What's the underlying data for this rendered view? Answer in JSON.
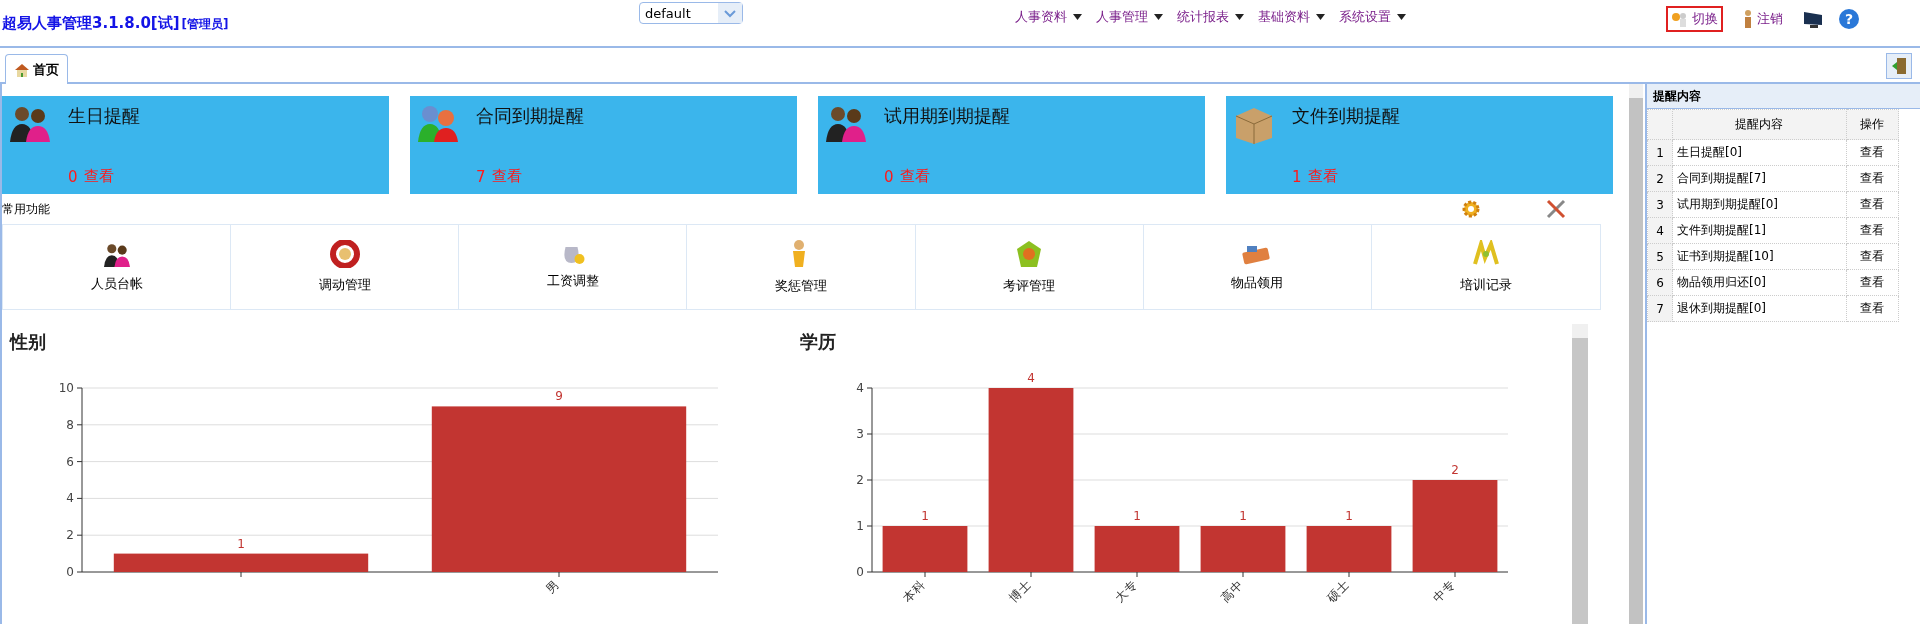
{
  "header": {
    "title": "超易人事管理3.1.8.0[试]",
    "role": "[管理员]",
    "theme_select": {
      "value": "default"
    },
    "menu": [
      {
        "label": "人事资料"
      },
      {
        "label": "人事管理"
      },
      {
        "label": "统计报表"
      },
      {
        "label": "基础资料"
      },
      {
        "label": "系统设置"
      }
    ],
    "actions": [
      {
        "label": "切换",
        "selected": true
      },
      {
        "label": "注销",
        "selected": false
      }
    ],
    "help_glyph": "?"
  },
  "tabs": [
    {
      "label": "首页",
      "selected": true
    }
  ],
  "reminder_cards": [
    {
      "title": "生日提醒",
      "count": "0",
      "link": "查看"
    },
    {
      "title": "合同到期提醒",
      "count": "7",
      "link": "查看"
    },
    {
      "title": "试用期到期提醒",
      "count": "0",
      "link": "查看"
    },
    {
      "title": "文件到期提醒",
      "count": "1",
      "link": "查看"
    }
  ],
  "common_functions": {
    "title": "常用功能",
    "items": [
      {
        "label": "人员台帐"
      },
      {
        "label": "调动管理"
      },
      {
        "label": "工资调整"
      },
      {
        "label": "奖惩管理"
      },
      {
        "label": "考评管理"
      },
      {
        "label": "物品领用"
      },
      {
        "label": "培训记录"
      }
    ]
  },
  "charts": [
    {
      "chart_data": {
        "type": "bar",
        "title": "性别",
        "categories": [
          null,
          "男"
        ],
        "values": [
          1,
          9
        ],
        "ylim": [
          0,
          10
        ],
        "yticks": [
          0,
          2,
          4,
          6,
          8,
          10
        ],
        "grid": true,
        "data_labels": true
      }
    },
    {
      "chart_data": {
        "type": "bar",
        "title": "学历",
        "categories": [
          "本科",
          "博士",
          "大专",
          "高中",
          "硕士",
          "中专"
        ],
        "values": [
          1,
          4,
          1,
          1,
          1,
          2
        ],
        "ylim": [
          0,
          4
        ],
        "yticks": [
          0,
          1,
          2,
          3,
          4
        ],
        "grid": true,
        "data_labels": true
      }
    }
  ],
  "reminder_panel": {
    "title": "提醒内容",
    "columns": [
      "提醒内容",
      "操作"
    ],
    "rows": [
      {
        "index": "1",
        "content": "生日提醒[0]",
        "action": "查看"
      },
      {
        "index": "2",
        "content": "合同到期提醒[7]",
        "action": "查看"
      },
      {
        "index": "3",
        "content": "试用期到期提醒[0]",
        "action": "查看"
      },
      {
        "index": "4",
        "content": "文件到期提醒[1]",
        "action": "查看"
      },
      {
        "index": "5",
        "content": "证书到期提醒[10]",
        "action": "查看"
      },
      {
        "index": "6",
        "content": "物品领用归还[0]",
        "action": "查看"
      },
      {
        "index": "7",
        "content": "退休到期提醒[0]",
        "action": "查看"
      }
    ]
  }
}
